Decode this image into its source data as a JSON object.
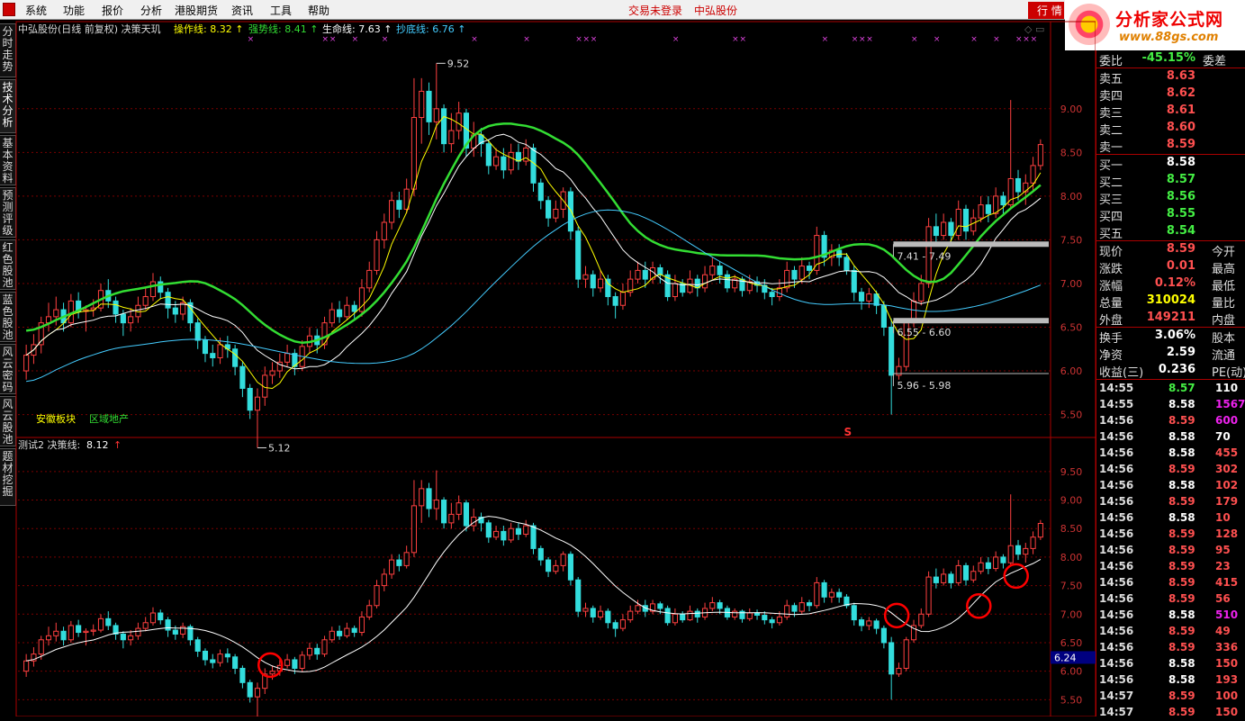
{
  "menu": {
    "items": [
      "系统",
      "功能",
      "报价",
      "分析",
      "港股期货",
      "资讯",
      "工具",
      "帮助"
    ],
    "login_status": "交易未登录",
    "stock_name": "中弘股份",
    "quote_tab": "行 情"
  },
  "brand": {
    "name": "分析家公式网",
    "url": "www.88gs.com"
  },
  "side_tabs": [
    "分时走势",
    "技术分析",
    "基本资料",
    "预测评级",
    "红色股池",
    "蓝色股池",
    "风云密码",
    "风云股池",
    "题材挖掘"
  ],
  "upper": {
    "title": "中弘股份(日线 前复权) 决策天玑",
    "indicators": [
      {
        "name": "操作线",
        "value": "8.32",
        "color": "#ffff00"
      },
      {
        "name": "强势线",
        "value": "8.41",
        "color": "#33dd33"
      },
      {
        "name": "生命线",
        "value": "7.63",
        "color": "#ffffff"
      },
      {
        "name": "抄底线",
        "value": "6.76",
        "color": "#44ccff"
      }
    ],
    "axis_ticks": [
      "9.00",
      "8.50",
      "8.00",
      "7.50",
      "7.00",
      "6.50",
      "6.00",
      "5.50"
    ],
    "ylim": [
      5.3,
      9.75
    ],
    "annotations": {
      "high": "9.52",
      "low": "5.12",
      "zone1": "7.41 - 7.49",
      "zone2": "6.55 - 6.60",
      "zone3": "5.96 - 5.98"
    },
    "sector_labels": [
      "安徽板块",
      "区域地产"
    ],
    "s_mark": "S"
  },
  "lower": {
    "title": "测试2 决策线:",
    "value": "8.12",
    "axis_ticks": [
      "9.50",
      "9.00",
      "8.50",
      "8.00",
      "7.50",
      "7.00",
      "6.50",
      "6.00",
      "5.50"
    ],
    "ylim": [
      5.3,
      9.75
    ],
    "cursor_price": "6.24"
  },
  "chart_data": {
    "type": "candlestick",
    "series": [
      {
        "name": "操作线",
        "value": 8.32
      },
      {
        "name": "强势线",
        "value": 8.41
      },
      {
        "name": "生命线",
        "value": 7.63
      },
      {
        "name": "抄底线",
        "value": 6.76
      },
      {
        "name": "决策线",
        "value": 8.12
      }
    ],
    "candles": [
      [
        6.0,
        6.18,
        6.3,
        5.9
      ],
      [
        6.18,
        6.3,
        6.42,
        6.08
      ],
      [
        6.3,
        6.55,
        6.62,
        6.2
      ],
      [
        6.55,
        6.62,
        6.78,
        6.45
      ],
      [
        6.62,
        6.7,
        6.85,
        6.52
      ],
      [
        6.7,
        6.55,
        6.78,
        6.45
      ],
      [
        6.55,
        6.8,
        6.88,
        6.5
      ],
      [
        6.8,
        6.68,
        6.9,
        6.6
      ],
      [
        6.68,
        6.7,
        6.75,
        6.45
      ],
      [
        6.7,
        6.72,
        6.82,
        6.62
      ],
      [
        6.72,
        6.92,
        7.0,
        6.68
      ],
      [
        6.92,
        6.8,
        7.05,
        6.72
      ],
      [
        6.8,
        6.65,
        6.85,
        6.55
      ],
      [
        6.65,
        6.55,
        6.7,
        6.4
      ],
      [
        6.55,
        6.62,
        6.72,
        6.45
      ],
      [
        6.62,
        6.75,
        6.85,
        6.55
      ],
      [
        6.75,
        6.85,
        6.95,
        6.7
      ],
      [
        6.85,
        7.02,
        7.12,
        6.8
      ],
      [
        7.02,
        6.9,
        7.08,
        6.82
      ],
      [
        6.9,
        6.72,
        6.95,
        6.6
      ],
      [
        6.72,
        6.65,
        6.8,
        6.55
      ],
      [
        6.65,
        6.78,
        6.85,
        6.58
      ],
      [
        6.78,
        6.55,
        6.82,
        6.45
      ],
      [
        6.55,
        6.35,
        6.6,
        6.25
      ],
      [
        6.35,
        6.2,
        6.4,
        6.1
      ],
      [
        6.2,
        6.15,
        6.3,
        6.05
      ],
      [
        6.15,
        6.3,
        6.38,
        6.08
      ],
      [
        6.3,
        6.25,
        6.4,
        6.15
      ],
      [
        6.25,
        6.05,
        6.3,
        5.95
      ],
      [
        6.05,
        5.8,
        6.1,
        5.7
      ],
      [
        5.8,
        5.55,
        5.85,
        5.45
      ],
      [
        5.55,
        5.7,
        5.8,
        5.12
      ],
      [
        5.7,
        5.95,
        6.05,
        5.6
      ],
      [
        5.95,
        6.0,
        6.1,
        5.85
      ],
      [
        6.0,
        6.1,
        6.2,
        5.92
      ],
      [
        6.1,
        6.2,
        6.3,
        6.05
      ],
      [
        6.2,
        6.05,
        6.25,
        5.95
      ],
      [
        6.05,
        6.28,
        6.35,
        6.0
      ],
      [
        6.28,
        6.4,
        6.5,
        6.2
      ],
      [
        6.4,
        6.3,
        6.48,
        6.2
      ],
      [
        6.3,
        6.55,
        6.62,
        6.25
      ],
      [
        6.55,
        6.7,
        6.78,
        6.5
      ],
      [
        6.7,
        6.62,
        6.8,
        6.55
      ],
      [
        6.62,
        6.75,
        6.85,
        6.58
      ],
      [
        6.75,
        6.68,
        6.8,
        6.6
      ],
      [
        6.68,
        6.95,
        7.05,
        6.62
      ],
      [
        6.95,
        7.15,
        7.25,
        6.9
      ],
      [
        7.15,
        7.5,
        7.6,
        7.1
      ],
      [
        7.5,
        7.7,
        7.8,
        7.4
      ],
      [
        7.7,
        7.95,
        8.05,
        7.62
      ],
      [
        7.95,
        7.85,
        8.05,
        7.75
      ],
      [
        7.85,
        8.08,
        8.2,
        7.8
      ],
      [
        8.08,
        8.9,
        9.35,
        8.0
      ],
      [
        8.9,
        9.2,
        9.35,
        8.6
      ],
      [
        9.2,
        8.85,
        9.3,
        8.7
      ],
      [
        8.85,
        9.0,
        9.52,
        8.65
      ],
      [
        9.0,
        8.6,
        9.05,
        8.5
      ],
      [
        8.6,
        8.75,
        8.95,
        8.5
      ],
      [
        8.75,
        8.95,
        9.08,
        8.65
      ],
      [
        8.95,
        8.55,
        9.0,
        8.45
      ],
      [
        8.55,
        8.7,
        8.85,
        8.45
      ],
      [
        8.7,
        8.6,
        8.78,
        8.45
      ],
      [
        8.6,
        8.35,
        8.65,
        8.25
      ],
      [
        8.35,
        8.45,
        8.55,
        8.3
      ],
      [
        8.45,
        8.3,
        8.55,
        8.2
      ],
      [
        8.3,
        8.5,
        8.6,
        8.25
      ],
      [
        8.5,
        8.4,
        8.6,
        8.3
      ],
      [
        8.4,
        8.55,
        8.65,
        8.35
      ],
      [
        8.55,
        8.15,
        8.6,
        8.05
      ],
      [
        8.15,
        7.95,
        8.2,
        7.85
      ],
      [
        7.95,
        7.75,
        8.0,
        7.65
      ],
      [
        7.75,
        7.85,
        7.95,
        7.7
      ],
      [
        7.85,
        8.05,
        8.1,
        7.75
      ],
      [
        8.05,
        7.6,
        8.1,
        7.5
      ],
      [
        7.6,
        7.05,
        7.65,
        6.95
      ],
      [
        7.05,
        7.1,
        7.2,
        6.95
      ],
      [
        7.1,
        6.95,
        7.15,
        6.85
      ],
      [
        6.95,
        7.05,
        7.15,
        6.9
      ],
      [
        7.05,
        6.85,
        7.1,
        6.75
      ],
      [
        6.85,
        6.75,
        6.9,
        6.6
      ],
      [
        6.75,
        6.9,
        7.0,
        6.7
      ],
      [
        6.9,
        7.05,
        7.15,
        6.85
      ],
      [
        7.05,
        7.15,
        7.25,
        7.0
      ],
      [
        7.15,
        7.05,
        7.25,
        6.95
      ],
      [
        7.05,
        7.18,
        7.25,
        7.0
      ],
      [
        7.18,
        7.1,
        7.22,
        7.0
      ],
      [
        7.1,
        6.85,
        7.15,
        6.8
      ],
      [
        6.85,
        7.0,
        7.1,
        6.8
      ],
      [
        7.0,
        6.9,
        7.05,
        6.85
      ],
      [
        6.9,
        7.05,
        7.15,
        6.88
      ],
      [
        7.05,
        6.95,
        7.1,
        6.85
      ],
      [
        6.95,
        7.1,
        7.2,
        6.9
      ],
      [
        7.1,
        7.2,
        7.3,
        7.05
      ],
      [
        7.2,
        7.1,
        7.25,
        7.0
      ],
      [
        7.1,
        6.95,
        7.15,
        6.9
      ],
      [
        6.95,
        7.05,
        7.1,
        6.9
      ],
      [
        7.05,
        6.92,
        7.08,
        6.85
      ],
      [
        6.92,
        7.02,
        7.1,
        6.88
      ],
      [
        7.02,
        6.98,
        7.08,
        6.9
      ],
      [
        6.98,
        6.9,
        7.05,
        6.82
      ],
      [
        6.9,
        6.85,
        6.95,
        6.75
      ],
      [
        6.85,
        6.95,
        7.05,
        6.8
      ],
      [
        6.95,
        7.15,
        7.25,
        6.9
      ],
      [
        7.15,
        7.05,
        7.2,
        6.95
      ],
      [
        7.05,
        7.2,
        7.3,
        7.0
      ],
      [
        7.2,
        7.15,
        7.25,
        7.05
      ],
      [
        7.15,
        7.55,
        7.65,
        7.1
      ],
      [
        7.55,
        7.3,
        7.6,
        7.2
      ],
      [
        7.3,
        7.38,
        7.45,
        7.2
      ],
      [
        7.38,
        7.3,
        7.45,
        7.2
      ],
      [
        7.3,
        7.15,
        7.35,
        7.1
      ],
      [
        7.15,
        6.9,
        7.2,
        6.8
      ],
      [
        6.9,
        6.8,
        6.95,
        6.7
      ],
      [
        6.8,
        6.88,
        6.95,
        6.72
      ],
      [
        6.88,
        6.75,
        6.92,
        6.65
      ],
      [
        6.75,
        6.5,
        6.8,
        6.4
      ],
      [
        6.5,
        5.95,
        6.6,
        5.5
      ],
      [
        5.95,
        6.05,
        6.15,
        5.9
      ],
      [
        6.05,
        6.55,
        6.6,
        6.0
      ],
      [
        6.55,
        6.8,
        6.9,
        6.5
      ],
      [
        6.8,
        7.0,
        7.1,
        6.75
      ],
      [
        7.0,
        7.65,
        7.75,
        6.95
      ],
      [
        7.65,
        7.55,
        7.8,
        7.45
      ],
      [
        7.55,
        7.7,
        7.8,
        7.5
      ],
      [
        7.7,
        7.55,
        7.75,
        7.45
      ],
      [
        7.55,
        7.85,
        7.95,
        7.5
      ],
      [
        7.85,
        7.6,
        7.9,
        7.5
      ],
      [
        7.6,
        7.75,
        7.85,
        7.55
      ],
      [
        7.75,
        7.9,
        8.0,
        7.7
      ],
      [
        7.9,
        7.8,
        8.0,
        7.7
      ],
      [
        7.8,
        8.0,
        8.1,
        7.75
      ],
      [
        8.0,
        7.9,
        8.05,
        7.8
      ],
      [
        7.9,
        8.2,
        9.1,
        7.85
      ],
      [
        8.2,
        8.05,
        8.3,
        7.95
      ],
      [
        8.05,
        8.15,
        8.25,
        7.9
      ],
      [
        8.15,
        8.35,
        8.45,
        8.05
      ],
      [
        8.35,
        8.59,
        8.65,
        8.3
      ]
    ]
  },
  "quote": {
    "weibi": {
      "label": "委比",
      "value": "-45.15%",
      "right": "委差"
    },
    "sell": [
      {
        "label": "卖五",
        "price": "8.63"
      },
      {
        "label": "卖四",
        "price": "8.62"
      },
      {
        "label": "卖三",
        "price": "8.61"
      },
      {
        "label": "卖二",
        "price": "8.60"
      },
      {
        "label": "卖一",
        "price": "8.59"
      }
    ],
    "buy": [
      {
        "label": "买一",
        "price": "8.58"
      },
      {
        "label": "买二",
        "price": "8.57"
      },
      {
        "label": "买三",
        "price": "8.56"
      },
      {
        "label": "买四",
        "price": "8.55"
      },
      {
        "label": "买五",
        "price": "8.54"
      }
    ],
    "stats": [
      {
        "k": "现价",
        "v": "8.59",
        "c": "red",
        "k2": "今开"
      },
      {
        "k": "涨跌",
        "v": "0.01",
        "c": "red",
        "k2": "最高"
      },
      {
        "k": "涨幅",
        "v": "0.12%",
        "c": "red",
        "k2": "最低"
      },
      {
        "k": "总量",
        "v": "310024",
        "c": "yel",
        "k2": "量比"
      },
      {
        "k": "外盘",
        "v": "149211",
        "c": "red",
        "k2": "内盘"
      }
    ],
    "stats2": [
      {
        "k": "换手",
        "v": "3.06%",
        "k2": "股本"
      },
      {
        "k": "净资",
        "v": "2.59",
        "k2": "流通"
      },
      {
        "k": "收益(三)",
        "v": "0.236",
        "k2": "PE(动)"
      }
    ],
    "ticks": [
      {
        "t": "14:55",
        "p": "8.57",
        "pc": "grn",
        "v": "110",
        "vc": "wht"
      },
      {
        "t": "14:55",
        "p": "8.58",
        "pc": "wht",
        "v": "1567",
        "vc": "mag"
      },
      {
        "t": "14:56",
        "p": "8.59",
        "pc": "red",
        "v": "600",
        "vc": "mag"
      },
      {
        "t": "14:56",
        "p": "8.58",
        "pc": "wht",
        "v": "70",
        "vc": "wht"
      },
      {
        "t": "14:56",
        "p": "8.58",
        "pc": "wht",
        "v": "455",
        "vc": "red"
      },
      {
        "t": "14:56",
        "p": "8.59",
        "pc": "red",
        "v": "302",
        "vc": "red"
      },
      {
        "t": "14:56",
        "p": "8.58",
        "pc": "wht",
        "v": "102",
        "vc": "red"
      },
      {
        "t": "14:56",
        "p": "8.59",
        "pc": "red",
        "v": "179",
        "vc": "red"
      },
      {
        "t": "14:56",
        "p": "8.58",
        "pc": "wht",
        "v": "10",
        "vc": "red"
      },
      {
        "t": "14:56",
        "p": "8.59",
        "pc": "red",
        "v": "128",
        "vc": "red"
      },
      {
        "t": "14:56",
        "p": "8.59",
        "pc": "red",
        "v": "95",
        "vc": "red"
      },
      {
        "t": "14:56",
        "p": "8.59",
        "pc": "red",
        "v": "23",
        "vc": "red"
      },
      {
        "t": "14:56",
        "p": "8.59",
        "pc": "red",
        "v": "415",
        "vc": "red"
      },
      {
        "t": "14:56",
        "p": "8.59",
        "pc": "red",
        "v": "56",
        "vc": "red"
      },
      {
        "t": "14:56",
        "p": "8.58",
        "pc": "wht",
        "v": "510",
        "vc": "mag"
      },
      {
        "t": "14:56",
        "p": "8.59",
        "pc": "red",
        "v": "49",
        "vc": "red"
      },
      {
        "t": "14:56",
        "p": "8.59",
        "pc": "red",
        "v": "336",
        "vc": "red"
      },
      {
        "t": "14:56",
        "p": "8.58",
        "pc": "wht",
        "v": "150",
        "vc": "red"
      },
      {
        "t": "14:56",
        "p": "8.58",
        "pc": "wht",
        "v": "193",
        "vc": "red"
      },
      {
        "t": "14:57",
        "p": "8.59",
        "pc": "red",
        "v": "100",
        "vc": "red"
      },
      {
        "t": "14:57",
        "p": "8.59",
        "pc": "red",
        "v": "150",
        "vc": "red"
      }
    ]
  },
  "colors": {
    "up": "#ff4040",
    "down": "#33dddd",
    "grid": "#7a0000",
    "caozuo": "#ffff00",
    "qiangshi": "#33dd33",
    "shengming": "#ffffff",
    "chaodi": "#44ccff",
    "circle": "#ff0000"
  }
}
